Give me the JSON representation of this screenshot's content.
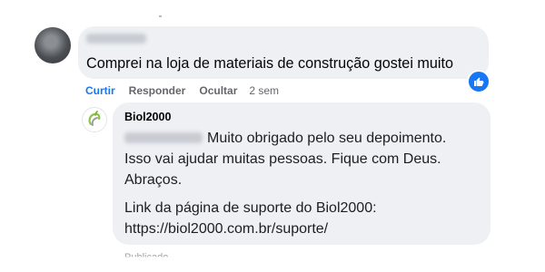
{
  "comment": {
    "text": "Comprei na loja de materiais de construção gostei muito",
    "actions": [
      "Curtir",
      "Responder",
      "Ocultar"
    ],
    "time": "2 sem",
    "reaction_icon": "like-thumb-icon"
  },
  "reply": {
    "author": "Biol2000",
    "lines": [
      "Muito obrigado pelo seu depoimento.",
      "Isso vai ajudar muitas pessoas. Fique com Deus.",
      "Abraços.",
      "Link da página de suporte do Biol2000:",
      "https://biol2000.com.br/suporte/"
    ],
    "footer_cutoff": "Publicado"
  },
  "colors": {
    "bubble": "#eef0f3",
    "like_blue": "#1877f2",
    "meta_gray": "#65676b"
  }
}
